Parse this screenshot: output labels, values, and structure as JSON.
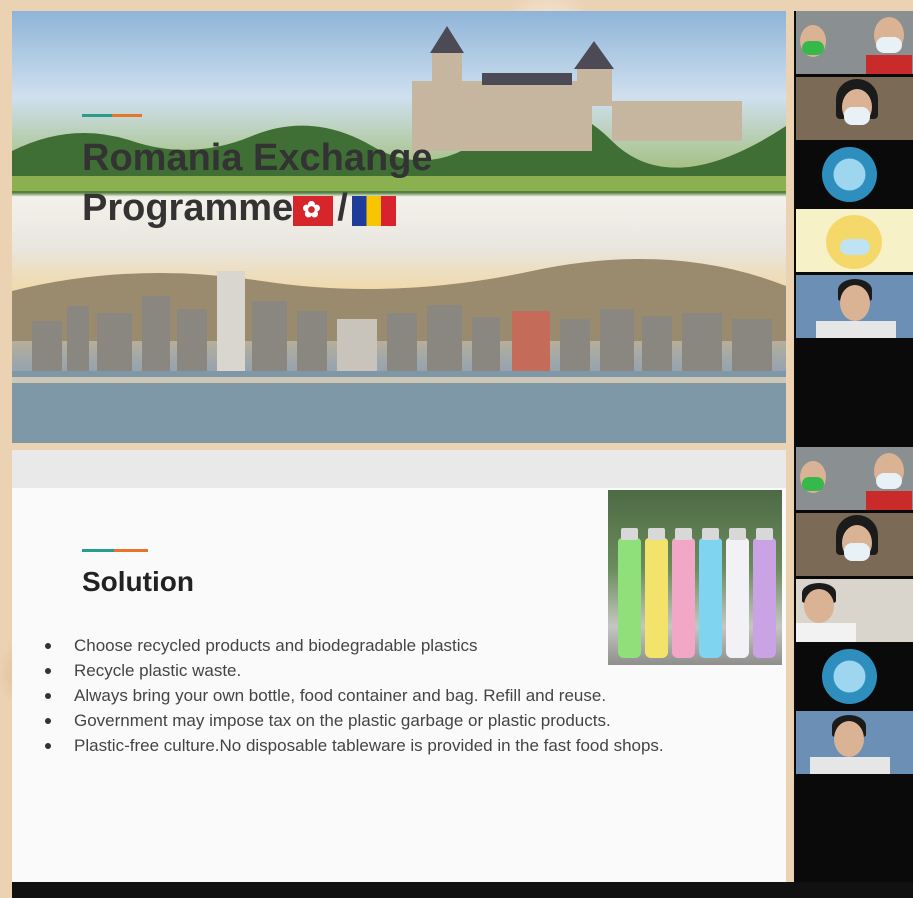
{
  "title_slide": {
    "title_line1": "Romania Exchange",
    "title_line2": "Programme",
    "separator": "/",
    "flags": [
      "hong-kong-flag-icon",
      "romania-flag-icon"
    ]
  },
  "solution_slide": {
    "title": "Solution",
    "bullets": [
      "Choose recycled products and biodegradable plastics",
      "Recycle  plastic waste.",
      "Always bring your own bottle, food container and bag. Refill and reuse.",
      "Government may impose tax on the plastic garbage or plastic products.",
      "Plastic-free culture.No disposable tableware is provided in the fast food shops."
    ],
    "photo_icon": "water-bottles-photo-icon"
  },
  "colors": {
    "accent_teal": "#2a9c8f",
    "accent_orange": "#e6752b",
    "hk_red": "#d7262b",
    "ro_blue": "#1f3c9a",
    "ro_yellow": "#f7c600",
    "ro_red": "#d8232e",
    "bottle_colors": [
      "#8fe07a",
      "#f3e36a",
      "#f2a7c7",
      "#7fd4ef",
      "#f1f1f6",
      "#c9a3e3"
    ]
  }
}
